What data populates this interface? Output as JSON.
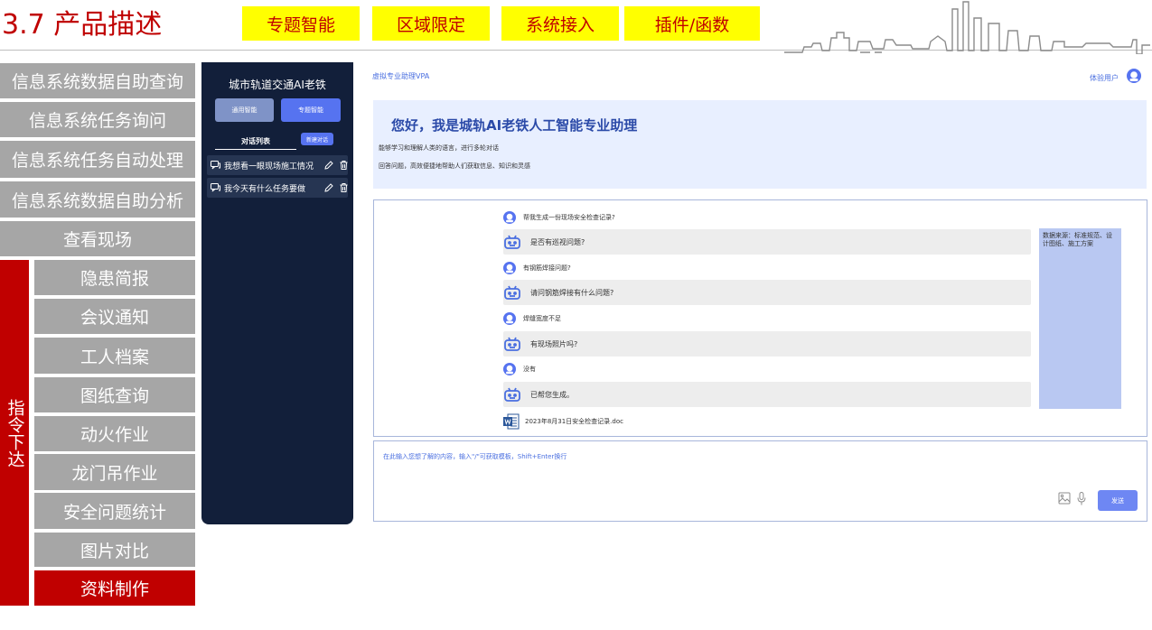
{
  "slide": {
    "title": "3.7 产品描述",
    "tags": [
      "专题智能",
      "区域限定",
      "系统接入",
      "插件/函数"
    ]
  },
  "menu": {
    "top_items": [
      "信息系统数据自助查询",
      "信息系统任务询问",
      "信息系统任务自动处理",
      "信息系统数据自助分析",
      "查看现场"
    ],
    "command_label": "指令下达",
    "sub_items": [
      "隐患简报",
      "会议通知",
      "工人档案",
      "图纸查询",
      "动火作业",
      "龙门吊作业",
      "安全问题统计",
      "图片对比",
      "资料制作"
    ],
    "active_sub_index": 8
  },
  "sidebar": {
    "title": "城市轨道交通AI老铁",
    "general_button": "通用智能",
    "special_button": "专题智能",
    "list_label": "对话列表",
    "new_button": "新建对话",
    "conversations": [
      "我想看一眼现场施工情况",
      "我今天有什么任务要做"
    ]
  },
  "app": {
    "header_title": "虚拟专业助理VPA",
    "user_label": "体验用户",
    "welcome": {
      "title": "您好，我是城轨AI老铁人工智能专业助理",
      "line1": "能够学习和理解人类的语言，进行多轮对话",
      "line2": "回答问题，高效便捷地帮助人们获取信息、知识和灵感"
    },
    "messages": [
      {
        "role": "user",
        "text": "帮我生成一份现场安全检查记录?"
      },
      {
        "role": "bot",
        "text": "是否有巡视问题?"
      },
      {
        "role": "user",
        "text": "有钢筋焊接问题?"
      },
      {
        "role": "bot",
        "text": "请问钢筋焊接有什么问题?"
      },
      {
        "role": "user",
        "text": "焊缝宽度不足"
      },
      {
        "role": "bot",
        "text": "有现场照片吗?"
      },
      {
        "role": "user",
        "text": "没有"
      },
      {
        "role": "bot",
        "text": "已帮您生成。"
      }
    ],
    "document_name": "2023年8月31日安全检查记录.doc",
    "source_note": "数据来源：标准规范、设计图纸、施工方案",
    "input_placeholder": "在此输入您想了解的内容，输入\"/\"可获取模板，Shift+Enter换行",
    "send_label": "发送"
  },
  "colors": {
    "brand_red": "#c00000",
    "tag_yellow": "#ffff00",
    "menu_gray": "#a6a6a6",
    "sidebar_dark": "#121f3a",
    "accent_blue": "#5673f0",
    "welcome_bg": "#e8efff",
    "source_bg": "#b9c8f2"
  }
}
